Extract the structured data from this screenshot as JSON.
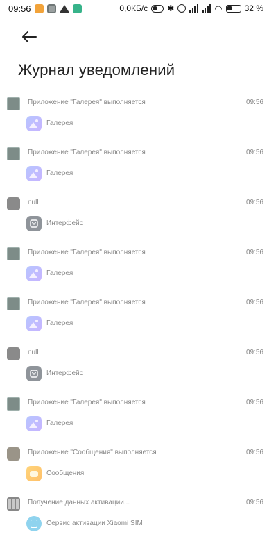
{
  "status_bar": {
    "time": "09:56",
    "net_speed": "0,0КБ/с",
    "battery_pct": "32",
    "battery_unit": "%"
  },
  "header": {
    "title": "Журнал уведомлений"
  },
  "entries": [
    {
      "title": "Приложение \"Галерея\" выполняется",
      "time": "09:56",
      "app": "Галерея",
      "icon": "gallery-icon"
    },
    {
      "title": "Приложение \"Галерея\" выполняется",
      "time": "09:56",
      "app": "Галерея",
      "icon": "gallery-icon"
    },
    {
      "title": "null",
      "time": "09:56",
      "app": "Интерфейс",
      "icon": "system-ui-icon"
    },
    {
      "title": "Приложение \"Галерея\" выполняется",
      "time": "09:56",
      "app": "Галерея",
      "icon": "gallery-icon"
    },
    {
      "title": "Приложение \"Галерея\" выполняется",
      "time": "09:56",
      "app": "Галерея",
      "icon": "gallery-icon"
    },
    {
      "title": "null",
      "time": "09:56",
      "app": "Интерфейс",
      "icon": "system-ui-icon"
    },
    {
      "title": "Приложение \"Галерея\" выполняется",
      "time": "09:56",
      "app": "Галерея",
      "icon": "gallery-icon"
    },
    {
      "title": "Приложение \"Сообщения\" выполняется",
      "time": "09:56",
      "app": "Сообщения",
      "icon": "messages-icon"
    },
    {
      "title": "Получение данных активации...",
      "time": "09:56",
      "app": "Сервис активации Xiaomi SIM",
      "icon": "sim-activation-icon"
    }
  ]
}
